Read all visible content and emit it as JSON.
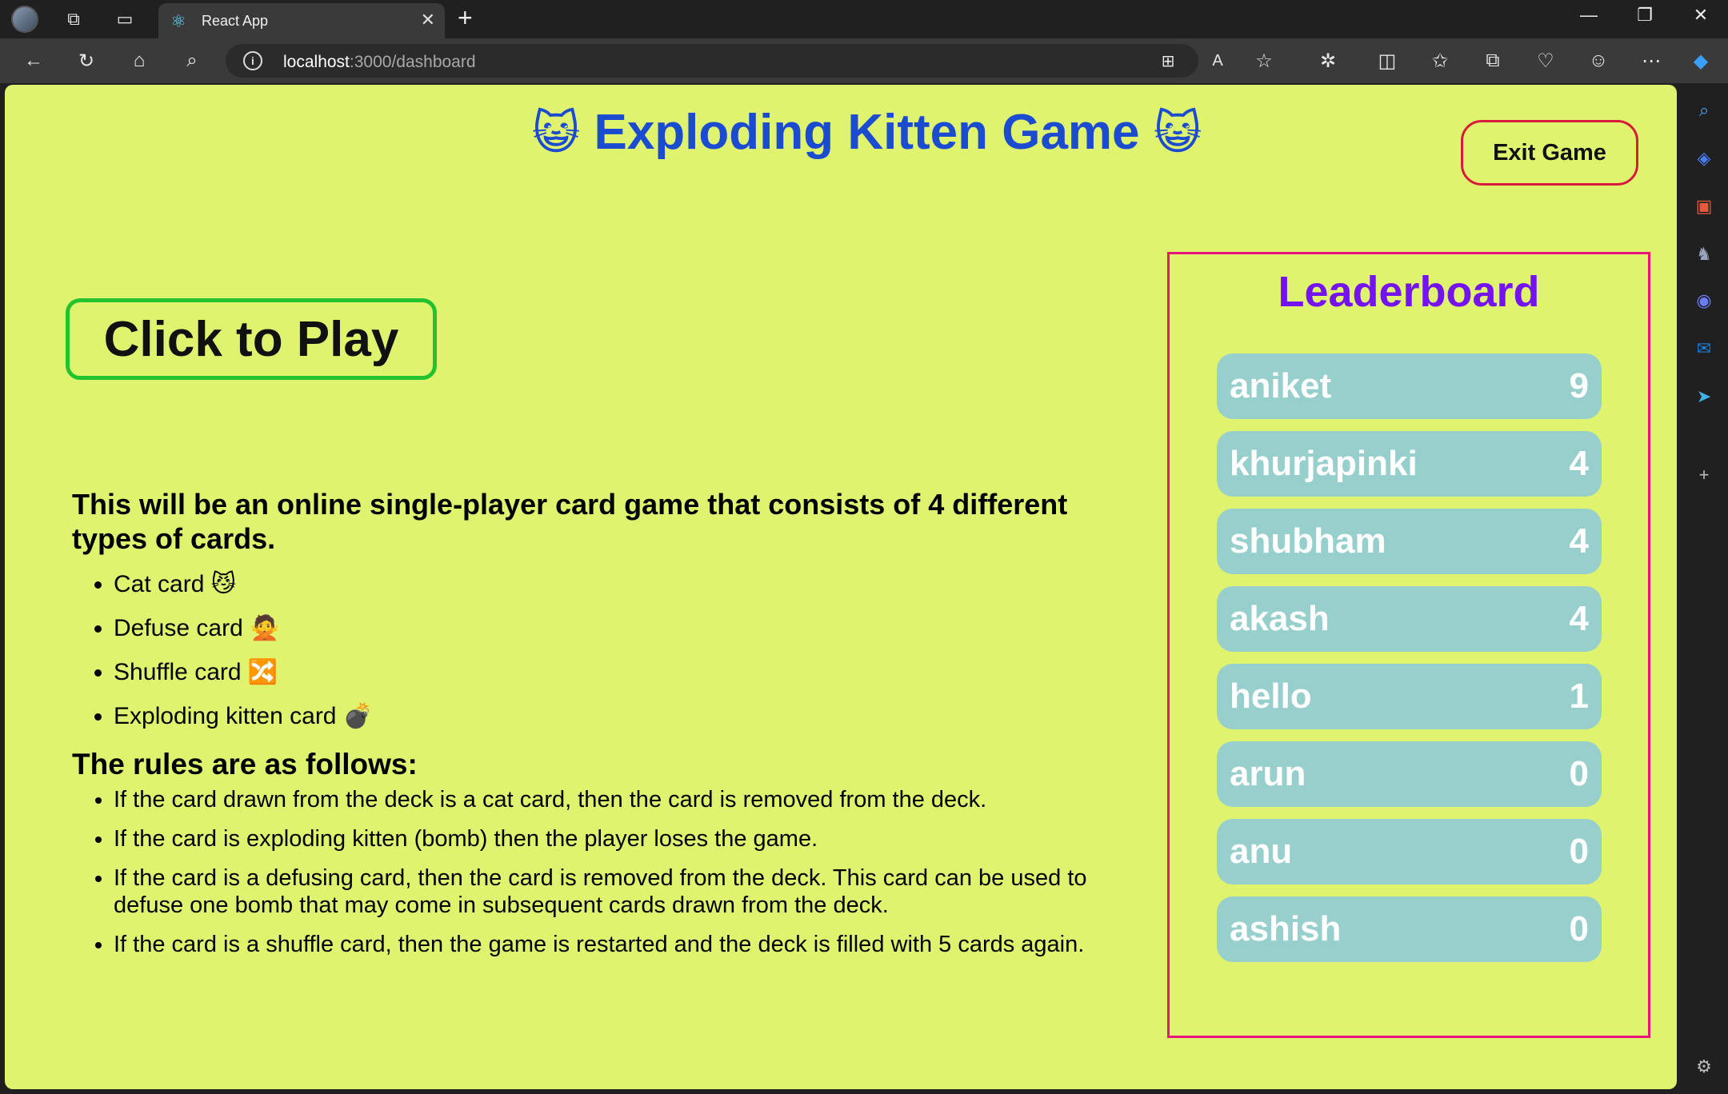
{
  "browser": {
    "tab_title": "React App",
    "url_host": "localhost",
    "url_path": ":3000/dashboard"
  },
  "page": {
    "title": "Exploding Kitten Game",
    "title_emoji": "😺",
    "exit_label": "Exit Game",
    "play_label": "Click to Play",
    "intro": "This will be an online single-player card game that consists of 4 different types of cards.",
    "card_types": [
      {
        "label": "Cat card",
        "emoji": "😼"
      },
      {
        "label": "Defuse card",
        "emoji": "🙅"
      },
      {
        "label": "Shuffle card",
        "emoji": "🔀"
      },
      {
        "label": "Exploding kitten card",
        "emoji": "💣"
      }
    ],
    "rules_heading": "The rules are as follows:",
    "rules": [
      "If the card drawn from the deck is a cat card, then the card is removed from the deck.",
      "If the card is exploding kitten (bomb) then the player loses the game.",
      "If the card is a defusing card, then the card is removed from the deck. This card can be used to defuse one bomb that may come in subsequent cards drawn from the deck.",
      "If the card is a shuffle card, then the game is restarted and the deck is filled with 5 cards again."
    ]
  },
  "leaderboard": {
    "title": "Leaderboard",
    "entries": [
      {
        "name": "aniket",
        "score": "9"
      },
      {
        "name": "khurjapinki",
        "score": "4"
      },
      {
        "name": "shubham",
        "score": "4"
      },
      {
        "name": "akash",
        "score": "4"
      },
      {
        "name": "hello",
        "score": "1"
      },
      {
        "name": "arun",
        "score": "0"
      },
      {
        "name": "anu",
        "score": "0"
      },
      {
        "name": "ashish",
        "score": "0"
      }
    ]
  },
  "colors": {
    "page_background": "#dff36f",
    "title": "#1a4bd1",
    "leaderboard_title": "#7412f0",
    "leaderboard_border": "#e8137b",
    "row_background": "#97cfcd",
    "play_border": "#22c32e",
    "exit_border": "#d81b3c"
  }
}
